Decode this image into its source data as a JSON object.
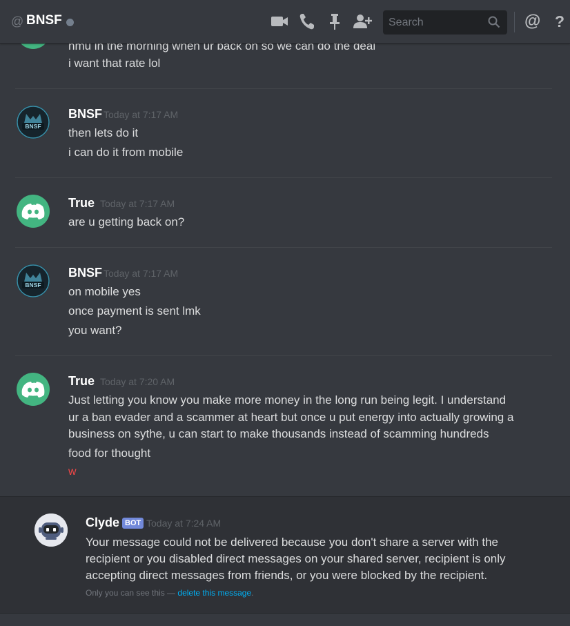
{
  "header": {
    "at_symbol": "@",
    "title": "BNSF",
    "search_placeholder": "Search",
    "mention_symbol": "@",
    "help_symbol": "?"
  },
  "messages": [
    {
      "author": "",
      "time": "",
      "lines": [
        "hmu in the morning when ur back on so we can do the deal",
        "i want that rate lol"
      ]
    },
    {
      "author": "BNSF",
      "time": "Today at 7:17 AM",
      "avatar_text": "BNSF",
      "lines": [
        "then lets do it",
        "i can do it from mobile"
      ]
    },
    {
      "author": "True",
      "time": "Today at 7:17 AM",
      "lines": [
        "are u getting back on?"
      ]
    },
    {
      "author": "BNSF",
      "time": "Today at 7:17 AM",
      "avatar_text": "BNSF",
      "lines": [
        "on mobile yes",
        "once payment is sent lmk",
        "you want?"
      ]
    },
    {
      "author": "True",
      "time": "Today at 7:20 AM",
      "lines": [
        "Just letting you know you make more money in the long run being legit. I understand",
        "ur a ban evader and a scammer at heart but once u put energy into actually growing a",
        "business on sythe, u can start to make thousands instead of scamming hundreds",
        "food for thought"
      ],
      "red_line": "w"
    }
  ],
  "clyde": {
    "author": "Clyde",
    "bot_tag": "BOT",
    "time": "Today at 7:24 AM",
    "lines": [
      "Your message could not be delivered because you don't share a server with the",
      "recipient or you disabled direct messages on your shared server, recipient is only",
      "accepting direct messages from friends, or you were blocked by the recipient."
    ],
    "note_prefix": "Only you can see this — ",
    "note_link": "delete this message",
    "note_suffix": "."
  },
  "colors": {
    "background": "#36393f",
    "discord_green": "#43b581",
    "bot_tag": "#7289da",
    "link": "#00b0f4",
    "red_text": "#f04747"
  },
  "icons": [
    "video-call-icon",
    "voice-call-icon",
    "pin-icon",
    "add-friend-icon",
    "search-icon",
    "mention-icon",
    "help-icon"
  ]
}
